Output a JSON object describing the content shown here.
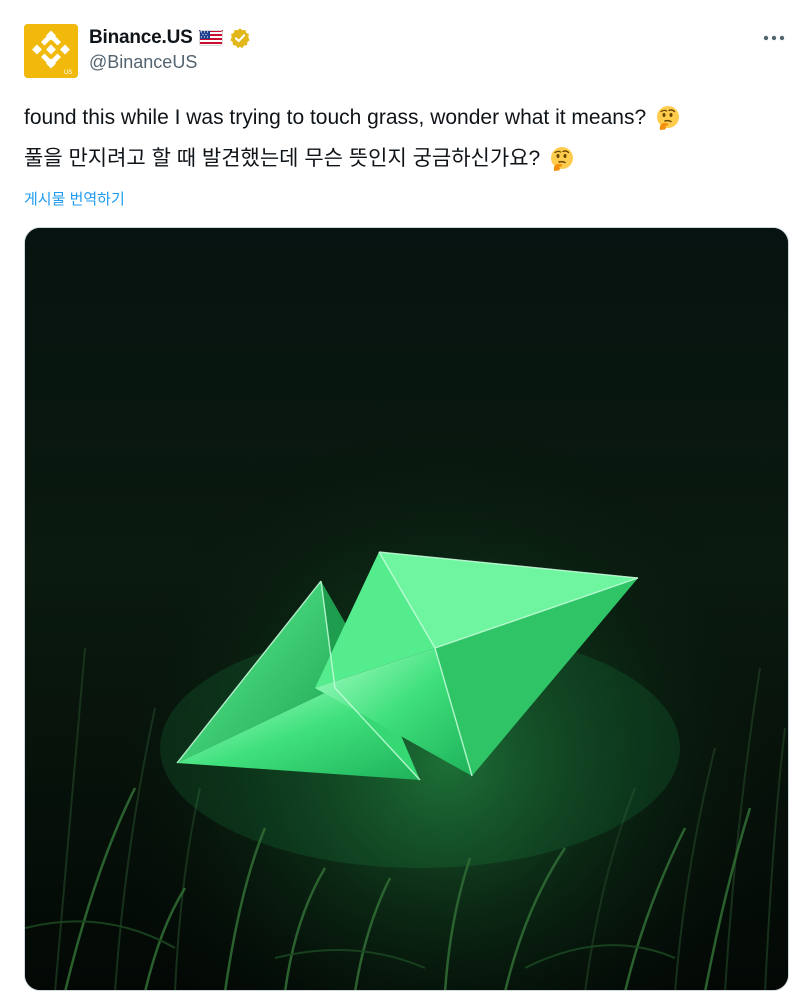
{
  "account": {
    "display_name": "Binance.US",
    "handle": "@BinanceUS",
    "avatar_icon": "binance-logo-icon",
    "avatar_logo_text": "US",
    "brand_color": "#f0b90b",
    "flag_icon": "us-flag-icon",
    "verified_icon": "gold-verified-badge-icon",
    "verified_color": "#e2b719"
  },
  "tweet": {
    "lines": [
      {
        "text": "found this while I was trying to touch grass, wonder what it means?",
        "emoji": "thinking-face-icon"
      },
      {
        "text": "풀을 만지려고 할 때 발견했는데 무슨 뜻인지 궁금하신가요?",
        "emoji": "thinking-face-icon"
      }
    ],
    "translate_label": "게시물 번역하기",
    "more_icon": "more-options-icon"
  },
  "media": {
    "description_icon": "glowing-green-ethereum-crystal-in-grass-image",
    "glow_color": "#35e07a"
  },
  "colors": {
    "text": "#0f1419",
    "secondary": "#536471",
    "link": "#1d9bf0"
  }
}
